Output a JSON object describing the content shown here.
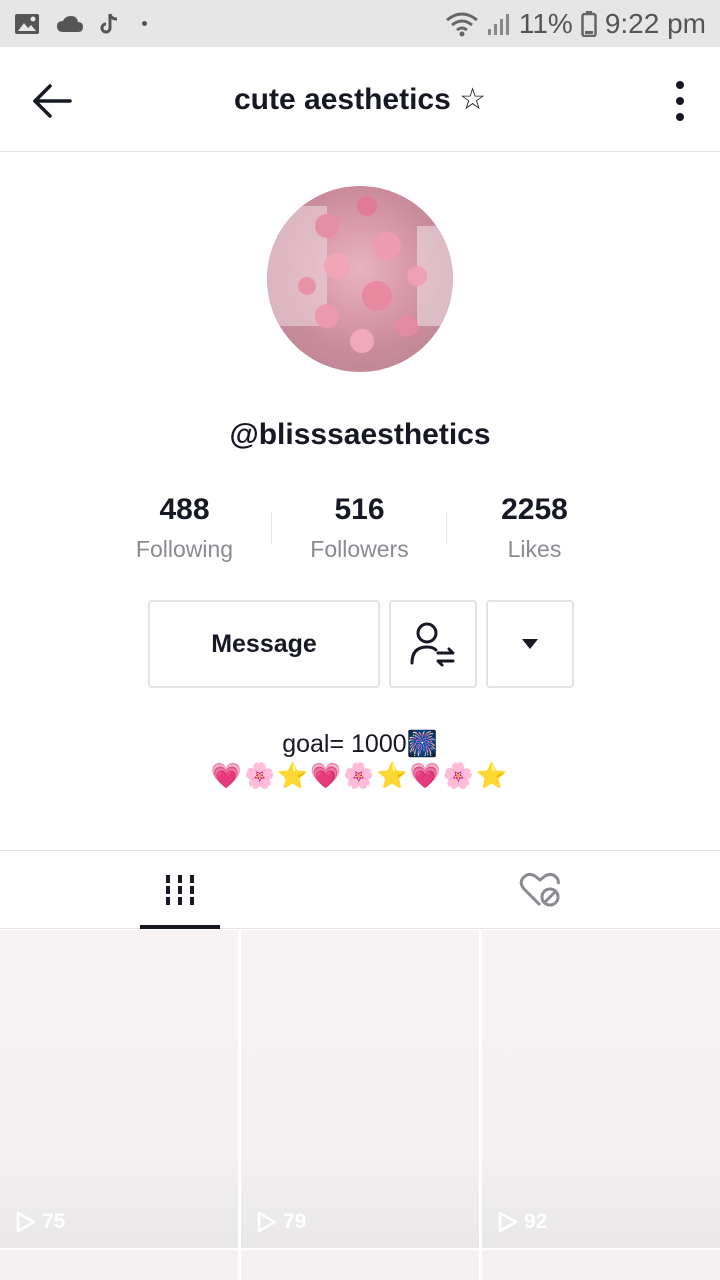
{
  "status_bar": {
    "battery": "11%",
    "time": "9:22 pm",
    "icons": [
      "gallery-icon",
      "cloud-icon",
      "tiktok-icon",
      "wifi-icon",
      "signal-icon",
      "battery-icon"
    ]
  },
  "header": {
    "title": "cute aesthetics ☆"
  },
  "profile": {
    "username": "@blisssaesthetics",
    "stats": [
      {
        "value": "488",
        "label": "Following"
      },
      {
        "value": "516",
        "label": "Followers"
      },
      {
        "value": "2258",
        "label": "Likes"
      }
    ],
    "bio_line1": "goal= 1000🎆",
    "bio_line2": "💗🌸⭐💗🌸⭐💗🌸⭐"
  },
  "actions": {
    "message_label": "Message"
  },
  "videos": [
    {
      "views": "75"
    },
    {
      "views": "79"
    },
    {
      "views": "92"
    }
  ]
}
